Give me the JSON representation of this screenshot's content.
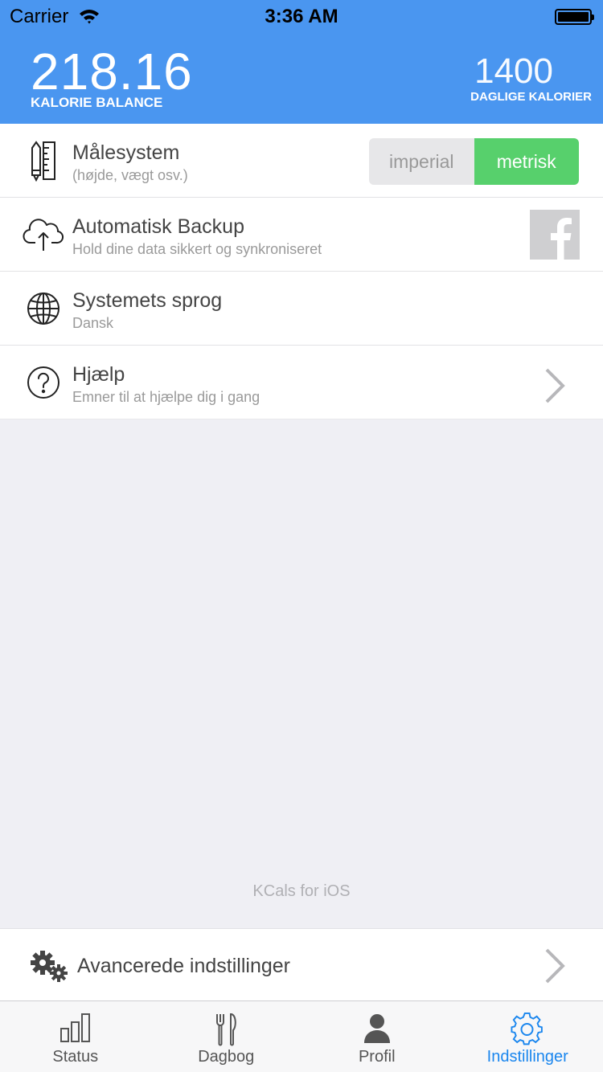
{
  "status_bar": {
    "carrier": "Carrier",
    "time": "3:36 AM"
  },
  "header": {
    "balance_value": "218.16",
    "balance_label": "KALORIE BALANCE",
    "daily_value": "1400",
    "daily_label": "DAGLIGE KALORIER",
    "background_color": "#4a96f0"
  },
  "settings": [
    {
      "icon": "ruler-pencil-icon",
      "title": "Målesystem",
      "subtitle": "(højde, vægt osv.)",
      "segment": {
        "options": [
          "imperial",
          "metrisk"
        ],
        "selected": "metrisk"
      }
    },
    {
      "icon": "cloud-upload-icon",
      "title": "Automatisk Backup",
      "subtitle": "Hold dine data sikkert og synkroniseret",
      "action_icon": "facebook-icon"
    },
    {
      "icon": "globe-icon",
      "title": "Systemets sprog",
      "subtitle": "Dansk"
    },
    {
      "icon": "question-circle-icon",
      "title": "Hjælp",
      "subtitle": "Emner til at hjælpe dig i gang",
      "action_icon": "chevron-right-icon"
    }
  ],
  "footer_text": "KCals for iOS",
  "advanced": {
    "icon": "gears-icon",
    "label": "Avancerede indstillinger"
  },
  "tabs": [
    {
      "label": "Status",
      "icon": "bar-chart-icon",
      "active": false
    },
    {
      "label": "Dagbog",
      "icon": "fork-knife-icon",
      "active": false
    },
    {
      "label": "Profil",
      "icon": "person-icon",
      "active": false
    },
    {
      "label": "Indstillinger",
      "icon": "gear-icon",
      "active": true
    }
  ],
  "colors": {
    "accent": "#1a86ee",
    "toggle_on": "#57d06c"
  }
}
